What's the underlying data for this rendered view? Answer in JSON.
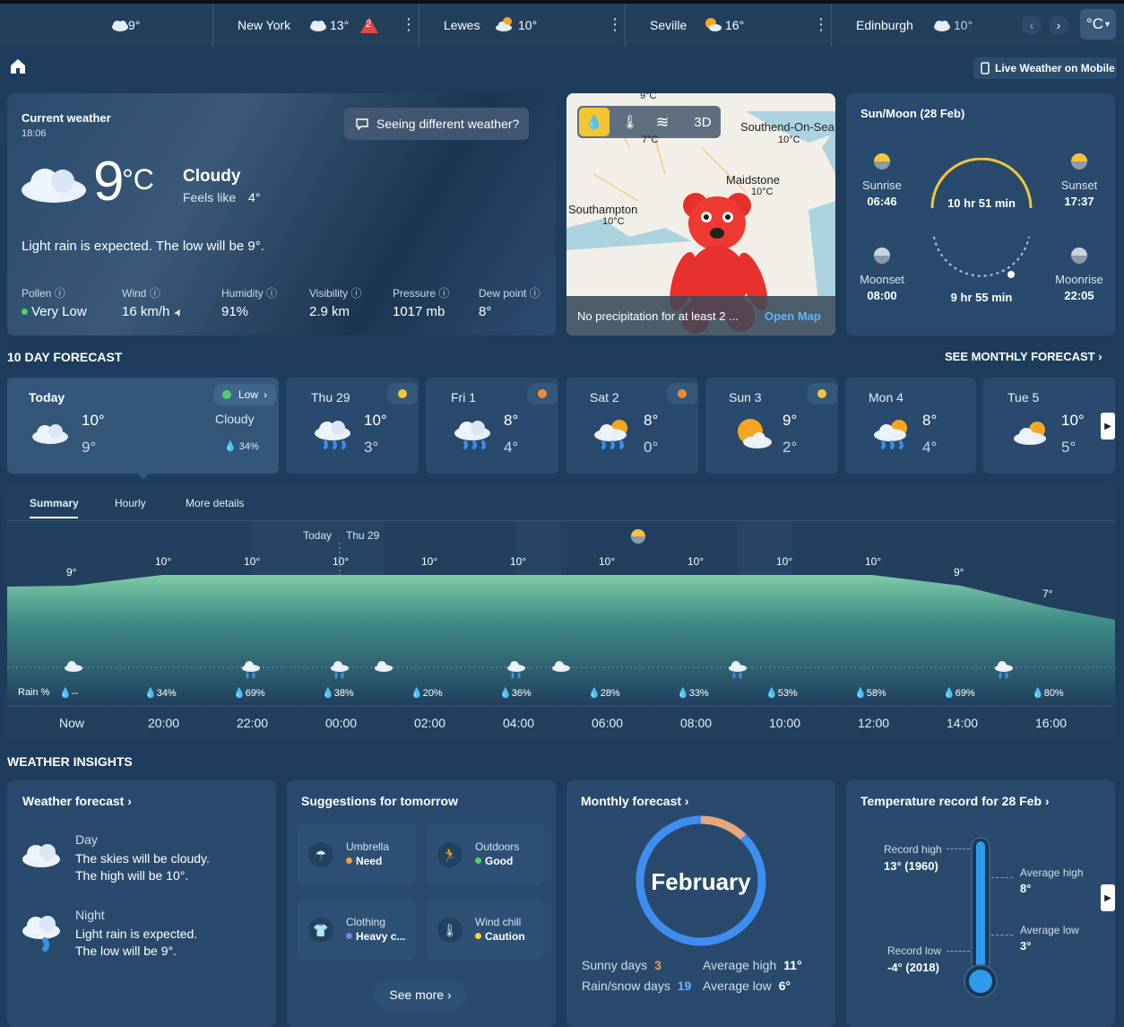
{
  "topbar": {
    "locations": [
      {
        "name": "",
        "temp": "9°",
        "icon": "cloud-icon"
      },
      {
        "name": "New York",
        "temp": "13°",
        "icon": "cloud-icon",
        "alert_count": "2"
      },
      {
        "name": "Lewes",
        "temp": "10°",
        "icon": "sun-cloud-icon"
      },
      {
        "name": "Seville",
        "temp": "16°",
        "icon": "sun-cloud-icon"
      },
      {
        "name": "Edinburgh",
        "temp": "10°",
        "icon": "cloud-icon"
      }
    ],
    "unit_label": "°C",
    "unit_chevron": "▾",
    "prev_icon": "‹",
    "next_icon": "›",
    "kebab": "⋮"
  },
  "subheader": {
    "mobile_label": "Live Weather on Mobile"
  },
  "current": {
    "title": "Current weather",
    "time": "18:06",
    "temp": "9",
    "unit": "°C",
    "condition": "Cloudy",
    "feels_like_label": "Feels like",
    "feels_like_value": "4°",
    "different_weather_label": "Seeing different weather?",
    "summary": "Light rain is expected. The low will be 9°.",
    "stats": [
      {
        "label": "Pollen",
        "value": "Very Low"
      },
      {
        "label": "Wind",
        "value": "16 km/h"
      },
      {
        "label": "Humidity",
        "value": "91%"
      },
      {
        "label": "Visibility",
        "value": "2.9 km"
      },
      {
        "label": "Pressure",
        "value": "1017 mb"
      },
      {
        "label": "Dew point",
        "value": "8°"
      }
    ],
    "info_glyph": "ⓘ",
    "wind_arrow": "➤"
  },
  "map": {
    "btn_3d": "3D",
    "places": [
      {
        "name": "Southend-On-Sea",
        "temp": "10°C"
      },
      {
        "name": "Maidstone",
        "temp": "10°C"
      },
      {
        "name": "Southampton",
        "temp": "10°C"
      },
      {
        "name": "",
        "temp": "9°C"
      },
      {
        "name": "",
        "temp": "7°C"
      }
    ],
    "footer_text": "No precipitation for at least 2 ...",
    "open_map": "Open Map",
    "drop_glyph": "💧",
    "thermo_glyph": "🌡",
    "wind_glyph": "≋"
  },
  "sunmoon": {
    "title": "Sun/Moon (28 Feb)",
    "sunrise_label": "Sunrise",
    "sunrise_time": "06:46",
    "sunset_label": "Sunset",
    "sunset_time": "17:37",
    "day_length": "10 hr 51 min",
    "moonset_label": "Moonset",
    "moonset_time": "08:00",
    "moonrise_label": "Moonrise",
    "moonrise_time": "22:05",
    "night_length": "9 hr 55 min",
    "colors": {
      "sun": "#f3c53a",
      "moon": "#b9c2cc"
    }
  },
  "forecast": {
    "section_title": "10 DAY FORECAST",
    "monthly_link": "SEE MONTHLY FORECAST",
    "chevron": "›",
    "days": [
      {
        "name": "Today",
        "hi": "10°",
        "lo": "9°",
        "cond": "Cloudy",
        "rain": "34%",
        "pollen": "Low"
      },
      {
        "name": "Thu 29",
        "hi": "10°",
        "lo": "3°"
      },
      {
        "name": "Fri 1",
        "hi": "8°",
        "lo": "4°"
      },
      {
        "name": "Sat 2",
        "hi": "8°",
        "lo": "0°"
      },
      {
        "name": "Sun 3",
        "hi": "9°",
        "lo": "2°"
      },
      {
        "name": "Mon 4",
        "hi": "8°",
        "lo": "4°"
      },
      {
        "name": "Tue 5",
        "hi": "10°",
        "lo": "5°"
      }
    ]
  },
  "hourly": {
    "tabs": [
      "Summary",
      "Hourly",
      "More details"
    ],
    "day_markers": [
      "Today",
      "Thu 29"
    ],
    "rain_label": "Rain %",
    "temps": [
      "9°",
      "10°",
      "10°",
      "10°",
      "10°",
      "10°",
      "10°",
      "10°",
      "10°",
      "10°",
      "9°",
      "7°"
    ],
    "rain": [
      "--",
      "34%",
      "69%",
      "38%",
      "20%",
      "36%",
      "28%",
      "33%",
      "53%",
      "58%",
      "69%",
      "80%"
    ],
    "hours": [
      "Now",
      "20:00",
      "22:00",
      "00:00",
      "02:00",
      "04:00",
      "06:00",
      "08:00",
      "10:00",
      "12:00",
      "14:00",
      "16:00"
    ],
    "drop_glyph": "💧"
  },
  "chart_data": {
    "type": "area",
    "x": [
      "Now",
      "20:00",
      "22:00",
      "00:00",
      "02:00",
      "04:00",
      "06:00",
      "08:00",
      "10:00",
      "12:00",
      "14:00",
      "16:00"
    ],
    "series": [
      {
        "values": [
          9,
          10,
          10,
          10,
          10,
          10,
          10,
          10,
          10,
          10,
          9,
          7
        ]
      }
    ],
    "rain_percent": [
      null,
      34,
      69,
      38,
      20,
      36,
      28,
      33,
      53,
      58,
      69,
      80
    ],
    "colors": {
      "fill_top": "#7fcaa6",
      "fill_bottom": "#2a5670"
    }
  },
  "insights": {
    "section_title": "WEATHER INSIGHTS",
    "forecast_card": {
      "title": "Weather forecast",
      "day_label": "Day",
      "day_line1": "The skies will be cloudy.",
      "day_line2": "The high will be 10°.",
      "night_label": "Night",
      "night_line1": "Light rain is expected.",
      "night_line2": "The low will be 9°."
    },
    "suggestions": {
      "title": "Suggestions for tomorrow",
      "items": [
        {
          "label": "Umbrella",
          "value": "Need",
          "color": "#f0a23a",
          "icon": "☂"
        },
        {
          "label": "Outdoors",
          "value": "Good",
          "color": "#4fd16a",
          "icon": "🏃"
        },
        {
          "label": "Clothing",
          "value": "Heavy c...",
          "color": "#7d7cf0",
          "icon": "👕"
        },
        {
          "label": "Wind chill",
          "value": "Caution",
          "color": "#f3d23a",
          "icon": "🌡"
        }
      ],
      "see_more": "See more"
    },
    "monthly": {
      "title": "Monthly forecast",
      "month": "February",
      "sunny_label": "Sunny days",
      "sunny_value": "3",
      "rain_label": "Rain/snow days",
      "rain_value": "19",
      "avg_high_label": "Average high",
      "avg_high_value": "11°",
      "avg_low_label": "Average low",
      "avg_low_value": "6°"
    },
    "record": {
      "title": "Temperature record for 28 Feb",
      "record_high_label": "Record high",
      "record_high_value": "13° (1960)",
      "record_low_label": "Record low",
      "record_low_value": "-4° (2018)",
      "avg_high_label": "Average high",
      "avg_high_value": "8°",
      "avg_low_label": "Average low",
      "avg_low_value": "3°"
    }
  }
}
